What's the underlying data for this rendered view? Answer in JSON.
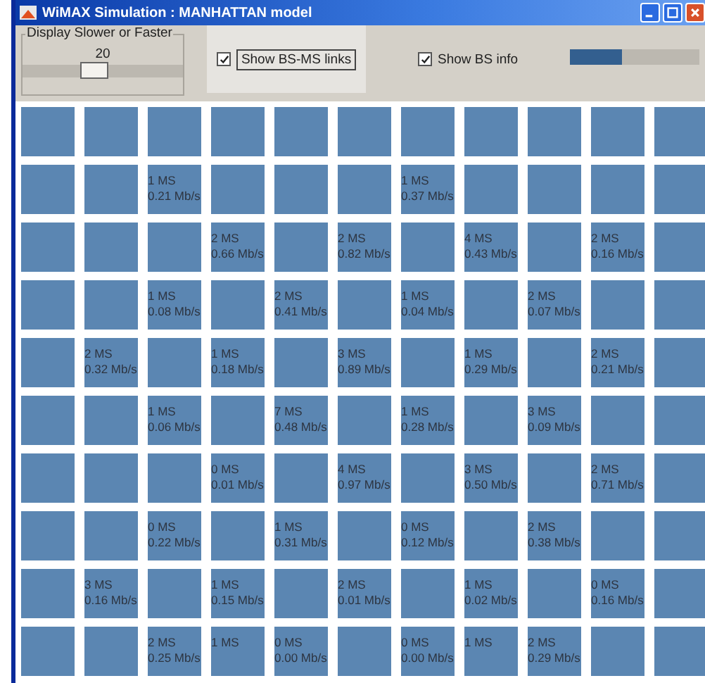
{
  "window": {
    "title": "WiMAX Simulation : MANHATTAN model"
  },
  "speed": {
    "label": "Display Slower or Faster",
    "value": "20",
    "level": 0.45
  },
  "options": [
    {
      "label": "Show BS-MS links",
      "checked": true,
      "focused": true
    },
    {
      "label": "Show BS info",
      "checked": true,
      "focused": false
    }
  ],
  "progress": {
    "level": 0.4
  },
  "grid": [
    {
      "cells": [
        {},
        {},
        {},
        {},
        {},
        {},
        {},
        {},
        {},
        {},
        {}
      ]
    },
    {
      "cells": [
        {},
        {},
        {
          "ms": "1 MS",
          "rate": "0.21 Mb/s"
        },
        {},
        {},
        {},
        {
          "ms": "1 MS",
          "rate": "0.37 Mb/s"
        },
        {},
        {},
        {},
        {}
      ]
    },
    {
      "cells": [
        {},
        {},
        {},
        {
          "ms": "2 MS",
          "rate": "0.66 Mb/s"
        },
        {},
        {
          "ms": "2 MS",
          "rate": "0.82 Mb/s"
        },
        {},
        {
          "ms": "4 MS",
          "rate": "0.43 Mb/s"
        },
        {},
        {
          "ms": "2 MS",
          "rate": "0.16 Mb/s"
        },
        {}
      ]
    },
    {
      "cells": [
        {},
        {},
        {
          "ms": "1 MS",
          "rate": "0.08 Mb/s"
        },
        {},
        {
          "ms": "2 MS",
          "rate": "0.41 Mb/s"
        },
        {},
        {
          "ms": "1 MS",
          "rate": "0.04 Mb/s"
        },
        {},
        {
          "ms": "2 MS",
          "rate": "0.07 Mb/s"
        },
        {},
        {}
      ]
    },
    {
      "cells": [
        {},
        {
          "ms": "2 MS",
          "rate": "0.32 Mb/s"
        },
        {},
        {
          "ms": "1 MS",
          "rate": "0.18 Mb/s"
        },
        {},
        {
          "ms": "3 MS",
          "rate": "0.89 Mb/s"
        },
        {},
        {
          "ms": "1 MS",
          "rate": "0.29 Mb/s"
        },
        {},
        {
          "ms": "2 MS",
          "rate": "0.21 Mb/s"
        },
        {}
      ]
    },
    {
      "cells": [
        {},
        {},
        {
          "ms": "1 MS",
          "rate": "0.06 Mb/s"
        },
        {},
        {
          "ms": "7 MS",
          "rate": "0.48 Mb/s"
        },
        {},
        {
          "ms": "1 MS",
          "rate": "0.28 Mb/s"
        },
        {},
        {
          "ms": "3 MS",
          "rate": "0.09 Mb/s"
        },
        {},
        {}
      ]
    },
    {
      "cells": [
        {},
        {},
        {},
        {
          "ms": "0 MS",
          "rate": "0.01 Mb/s"
        },
        {},
        {
          "ms": "4 MS",
          "rate": "0.97 Mb/s"
        },
        {},
        {
          "ms": "3 MS",
          "rate": "0.50 Mb/s"
        },
        {},
        {
          "ms": "2 MS",
          "rate": "0.71 Mb/s"
        },
        {}
      ]
    },
    {
      "cells": [
        {},
        {},
        {
          "ms": "0 MS",
          "rate": "0.22 Mb/s"
        },
        {},
        {
          "ms": "1 MS",
          "rate": "0.31 Mb/s"
        },
        {},
        {
          "ms": "0 MS",
          "rate": "0.12 Mb/s"
        },
        {},
        {
          "ms": "2 MS",
          "rate": "0.38 Mb/s"
        },
        {},
        {}
      ]
    },
    {
      "cells": [
        {},
        {
          "ms": "3 MS",
          "rate": "0.16 Mb/s"
        },
        {},
        {
          "ms": "1 MS",
          "rate": "0.15 Mb/s"
        },
        {},
        {
          "ms": "2 MS",
          "rate": "0.01 Mb/s"
        },
        {},
        {
          "ms": "1 MS",
          "rate": "0.02 Mb/s"
        },
        {},
        {
          "ms": "0 MS",
          "rate": "0.16 Mb/s"
        },
        {}
      ]
    },
    {
      "cells": [
        {},
        {},
        {
          "ms": "2 MS",
          "rate": "0.25 Mb/s"
        },
        {
          "ms": "1 MS"
        },
        {
          "ms": "0 MS",
          "rate": "0.00 Mb/s"
        },
        {},
        {
          "ms": "0 MS",
          "rate": "0.00 Mb/s"
        },
        {
          "ms": "1 MS"
        },
        {
          "ms": "2 MS",
          "rate": "0.29 Mb/s"
        },
        {},
        {}
      ]
    }
  ]
}
